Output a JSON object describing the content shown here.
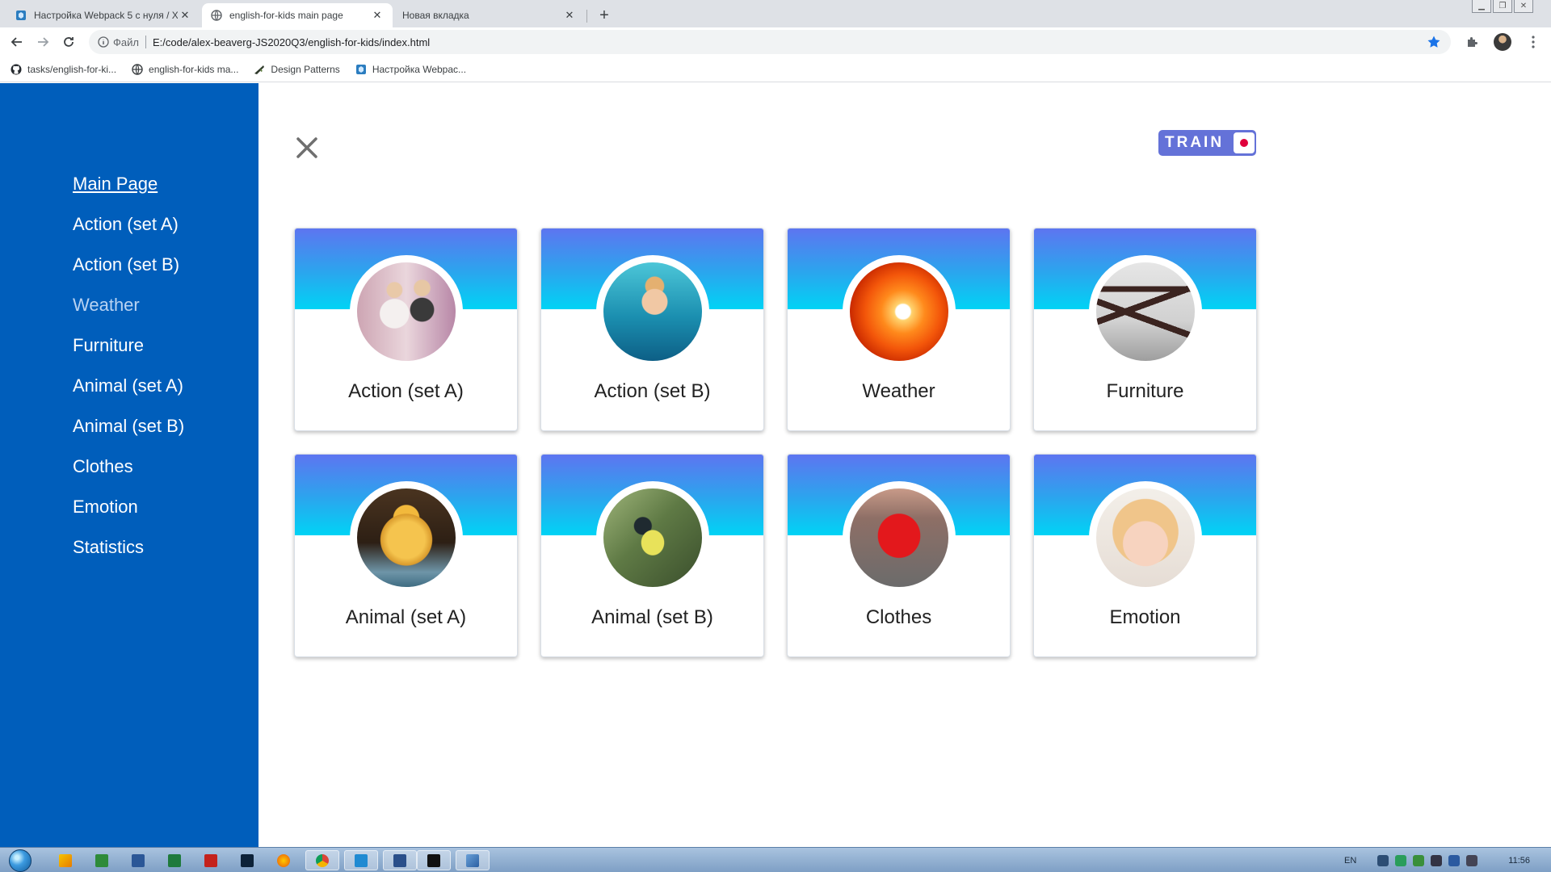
{
  "browser": {
    "tabs": [
      {
        "title": "Настройка Webpack 5 с нуля / Х",
        "active": false
      },
      {
        "title": "english-for-kids main page",
        "active": true
      },
      {
        "title": "Новая вкладка",
        "active": false
      }
    ],
    "omnibox": {
      "scheme": "Файл",
      "url": "E:/code/alex-beaverg-JS2020Q3/english-for-kids/index.html"
    },
    "bookmarks": [
      {
        "label": "tasks/english-for-ki...",
        "icon": "github-icon"
      },
      {
        "label": "english-for-kids ma...",
        "icon": "globe-icon"
      },
      {
        "label": "Design Patterns",
        "icon": "design-patterns-icon"
      },
      {
        "label": "Настройка Webpac...",
        "icon": "webpack-icon"
      }
    ]
  },
  "colors": {
    "sidebar": "#005ebb",
    "switch": "#6472d8",
    "switch_dot": "#e0003c",
    "band_top": "#5d75f0",
    "band_bottom": "#00d3f5"
  },
  "sidebar": {
    "items": [
      {
        "label": "Main Page",
        "state": "current"
      },
      {
        "label": "Action (set A)"
      },
      {
        "label": "Action (set B)"
      },
      {
        "label": "Weather",
        "state": "active"
      },
      {
        "label": "Furniture"
      },
      {
        "label": "Animal (set A)"
      },
      {
        "label": "Animal (set B)"
      },
      {
        "label": "Clothes"
      },
      {
        "label": "Emotion"
      },
      {
        "label": "Statistics"
      }
    ]
  },
  "header": {
    "close_icon": "close-icon",
    "mode_label": "TRAIN"
  },
  "categories": [
    {
      "title": "Action (set A)",
      "image": "children-dancing"
    },
    {
      "title": "Action (set B)",
      "image": "child-swimming"
    },
    {
      "title": "Weather",
      "image": "sunset"
    },
    {
      "title": "Furniture",
      "image": "table"
    },
    {
      "title": "Animal (set A)",
      "image": "chick"
    },
    {
      "title": "Animal (set B)",
      "image": "tit-bird"
    },
    {
      "title": "Clothes",
      "image": "red-blouse"
    },
    {
      "title": "Emotion",
      "image": "smiling-girl"
    }
  ],
  "taskbar": {
    "language": "EN",
    "time": "11:56"
  }
}
